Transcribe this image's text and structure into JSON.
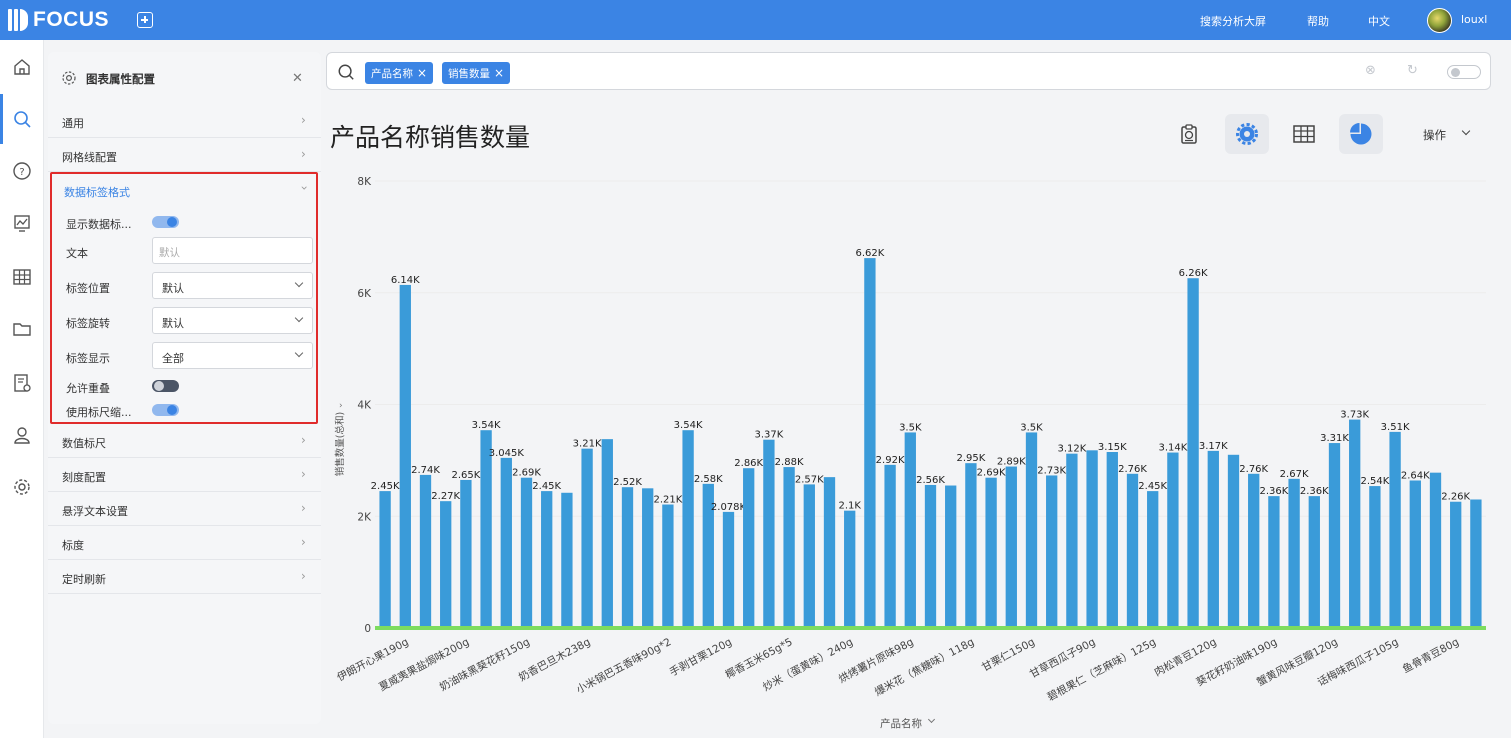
{
  "app": {
    "logo": "FOCUS"
  },
  "topbar": {
    "links": [
      "搜索分析大屏",
      "帮助",
      "中文"
    ],
    "user": "louxl"
  },
  "config": {
    "title": "图表属性配置",
    "sections_top": [
      "通用",
      "网格线配置"
    ],
    "expanded": {
      "title": "数据标签格式",
      "show_labels": {
        "label": "显示数据标...",
        "on": true
      },
      "text": {
        "label": "文本",
        "placeholder": "默认"
      },
      "position": {
        "label": "标签位置",
        "value": "默认"
      },
      "rotation": {
        "label": "标签旋转",
        "value": "默认"
      },
      "display": {
        "label": "标签显示",
        "value": "全部"
      },
      "overlap": {
        "label": "允许重叠",
        "on": false
      },
      "scale": {
        "label": "使用标尺缩...",
        "on": true
      }
    },
    "sections_bottom": [
      "数值标尺",
      "刻度配置",
      "悬浮文本设置",
      "标度",
      "定时刷新"
    ]
  },
  "search": {
    "chips": [
      "产品名称",
      "销售数量"
    ]
  },
  "main": {
    "title": "产品名称销售数量",
    "ops_label": "操作"
  },
  "colors": {
    "accent": "#3b84e4",
    "bar": "#3a9bd9",
    "baseline": "#7ddc5f"
  },
  "chart_data": {
    "type": "bar",
    "xlabel": "产品名称",
    "ylabel": "销售数量(总和)",
    "ylim": [
      0,
      8000
    ],
    "yticks": [
      "0",
      "2K",
      "4K",
      "6K",
      "8K"
    ],
    "grid": true,
    "values": [
      2450,
      6140,
      2740,
      2270,
      2650,
      3540,
      3045,
      2690,
      2450,
      2420,
      3210,
      3380,
      2520,
      2500,
      2210,
      3540,
      2580,
      2078,
      2860,
      3370,
      2880,
      2570,
      2700,
      2100,
      6620,
      2920,
      3500,
      2560,
      2550,
      2950,
      2690,
      2890,
      3500,
      2730,
      3120,
      3180,
      3150,
      2760,
      2450,
      3140,
      6260,
      3170,
      3100,
      2760,
      2360,
      2670,
      2360,
      3310,
      3730,
      2540,
      3510,
      2640,
      2780,
      2260,
      2300
    ],
    "data_labels": {
      "0": "2.45K",
      "1": "6.14K",
      "2": "2.74K",
      "3": "2.27K",
      "4": "2.65K",
      "5": "3.54K",
      "6": "3.045K",
      "7": "2.69K",
      "8": "2.45K",
      "10": "3.21K",
      "12": "2.52K",
      "14": "2.21K",
      "15": "3.54K",
      "16": "2.58K",
      "17": "2.078K",
      "18": "2.86K",
      "19": "3.37K",
      "20": "2.88K",
      "21": "2.57K",
      "23": "2.1K",
      "24": "6.62K",
      "25": "2.92K",
      "26": "3.5K",
      "27": "2.56K",
      "29": "2.95K",
      "30": "2.69K",
      "31": "2.89K",
      "32": "3.5K",
      "33": "2.73K",
      "34": "3.12K",
      "36": "3.15K",
      "37": "2.76K",
      "38": "2.45K",
      "39": "3.14K",
      "40": "6.26K",
      "41": "3.17K",
      "43": "2.76K",
      "44": "2.36K",
      "45": "2.67K",
      "46": "2.36K",
      "47": "3.31K",
      "48": "3.73K",
      "49": "2.54K",
      "50": "3.51K",
      "51": "2.64K",
      "53": "2.26K"
    },
    "categories": {
      "1": "伊朗开心果190g",
      "4": "夏威夷果盐焗味200g",
      "7": "奶油味黑葵花籽150g",
      "10": "奶香巴旦木238g",
      "14": "小米锅巴五香味90g*2",
      "17": "手剥甘栗120g",
      "20": "椰香玉米65g*5",
      "23": "炒米（蛋黄味）240g",
      "26": "烘烤薯片原味98g",
      "29": "爆米花（焦糖味）118g",
      "32": "甘栗仁150g",
      "35": "甘草西瓜子90g",
      "38": "碧根果仁（芝麻味）125g",
      "41": "肉松青豆120g",
      "44": "葵花籽奶油味190g",
      "47": "蟹黄风味豆瓣120g",
      "50": "话梅味西瓜子105g",
      "53": "鱼骨青豆80g"
    }
  }
}
